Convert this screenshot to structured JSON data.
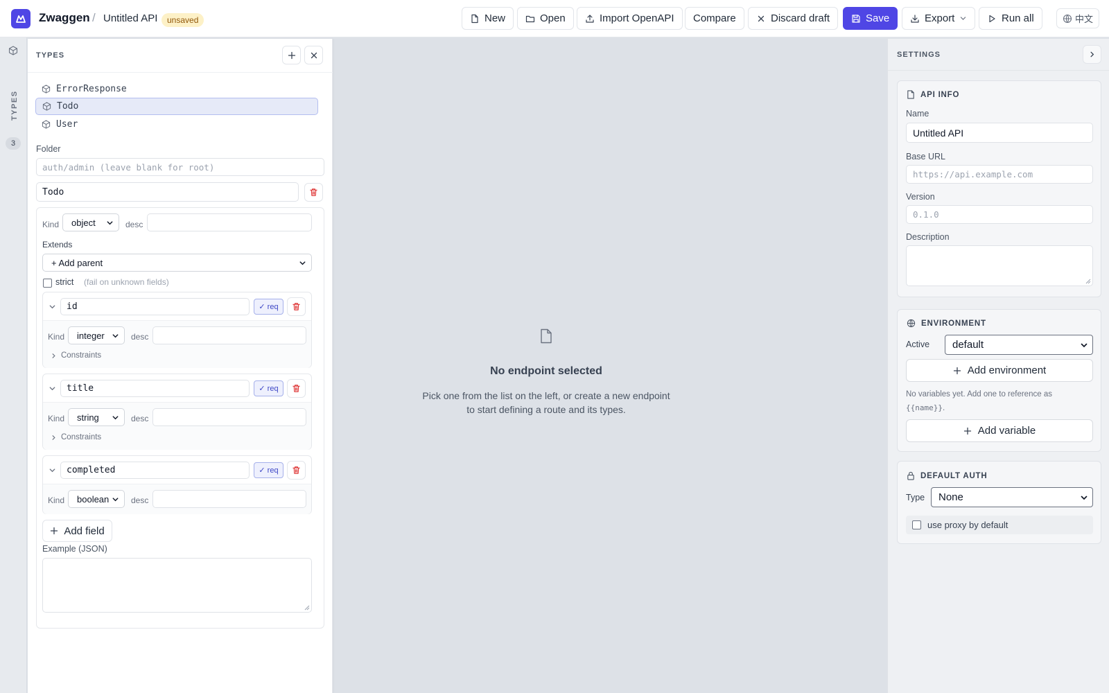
{
  "header": {
    "brand": "Zwaggen",
    "separator": "/",
    "api_name": "Untitled API",
    "status_badge": "unsaved",
    "buttons": {
      "new": "New",
      "open": "Open",
      "import": "Import OpenAPI",
      "compare": "Compare",
      "discard": "Discard draft",
      "save": "Save",
      "export": "Export",
      "run_all": "Run all",
      "language": "中文"
    }
  },
  "rail": {
    "label": "TYPES",
    "count": "3"
  },
  "types_panel": {
    "title": "TYPES",
    "types": [
      {
        "name": "ErrorResponse",
        "selected": false
      },
      {
        "name": "Todo",
        "selected": true
      },
      {
        "name": "User",
        "selected": false
      }
    ],
    "folder_label": "Folder",
    "folder_placeholder": "auth/admin (leave blank for root)",
    "type_name": "Todo",
    "kind_label": "Kind",
    "kind_value": "object",
    "desc_label": "desc",
    "extends_label": "Extends",
    "add_parent": "+ Add parent",
    "strict_label": "strict",
    "strict_hint": "(fail on unknown fields)",
    "fields": [
      {
        "name": "id",
        "req": "✓ req",
        "kind": "integer",
        "constraints": "Constraints"
      },
      {
        "name": "title",
        "req": "✓ req",
        "kind": "string",
        "constraints": "Constraints"
      },
      {
        "name": "completed",
        "req": "✓ req",
        "kind": "boolean"
      }
    ],
    "add_field": "Add field",
    "example_label": "Example (JSON)"
  },
  "center": {
    "title": "No endpoint selected",
    "desc_line1": "Pick one from the list on the left, or create a new endpoint",
    "desc_line2": "to start defining a route and its types."
  },
  "settings": {
    "title": "SETTINGS",
    "api_info": {
      "title": "API INFO",
      "name_label": "Name",
      "name_value": "Untitled API",
      "base_url_label": "Base URL",
      "base_url_placeholder": "https://api.example.com",
      "version_label": "Version",
      "version_placeholder": "0.1.0",
      "description_label": "Description"
    },
    "environment": {
      "title": "ENVIRONMENT",
      "active_label": "Active",
      "active_value": "default",
      "add_env": "Add environment",
      "hint_line1": "No variables yet. Add one to reference as",
      "hint_code": "{{name}}",
      "hint_end": ".",
      "add_var": "Add variable"
    },
    "auth": {
      "title": "DEFAULT AUTH",
      "type_label": "Type",
      "type_value": "None",
      "proxy_label": "use proxy by default"
    }
  },
  "colors": {
    "accent": "#4f46e5",
    "danger": "#dc2626",
    "badge_bg": "#fdf1c7"
  }
}
